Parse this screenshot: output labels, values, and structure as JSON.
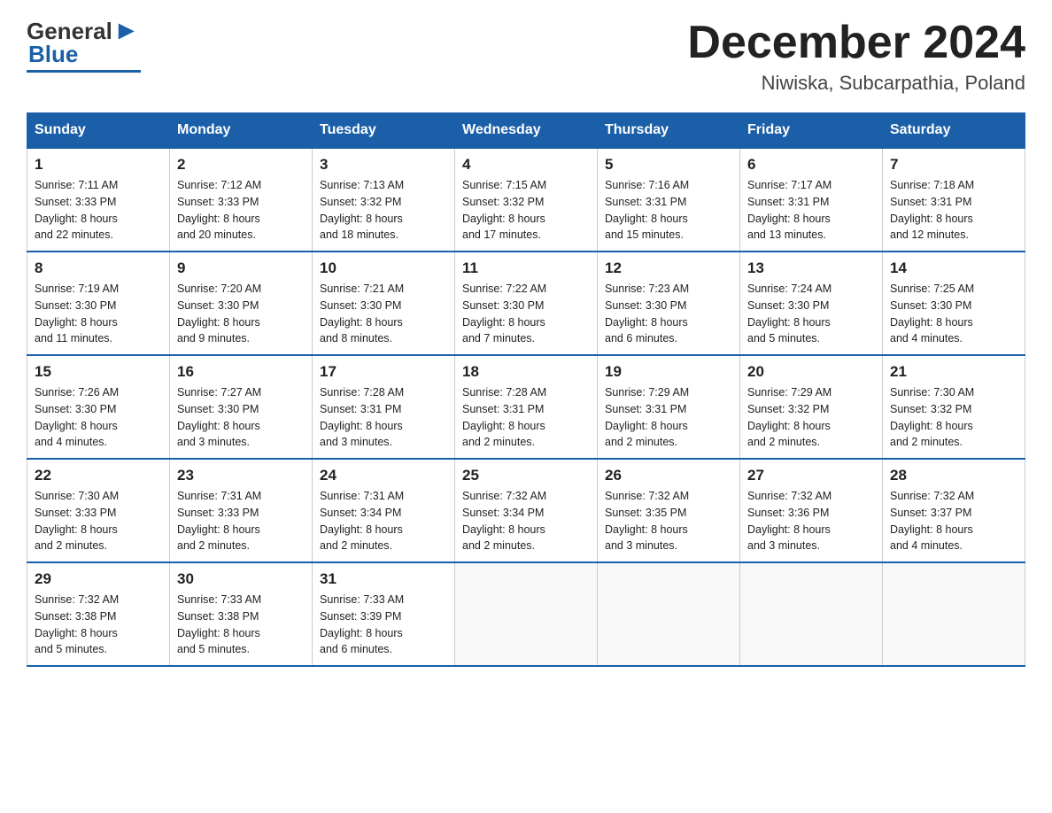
{
  "header": {
    "logo_general": "General",
    "logo_blue": "Blue",
    "month_title": "December 2024",
    "location": "Niwiska, Subcarpathia, Poland"
  },
  "days_of_week": [
    "Sunday",
    "Monday",
    "Tuesday",
    "Wednesday",
    "Thursday",
    "Friday",
    "Saturday"
  ],
  "weeks": [
    [
      {
        "day": "1",
        "sunrise": "7:11 AM",
        "sunset": "3:33 PM",
        "daylight": "8 hours and 22 minutes."
      },
      {
        "day": "2",
        "sunrise": "7:12 AM",
        "sunset": "3:33 PM",
        "daylight": "8 hours and 20 minutes."
      },
      {
        "day": "3",
        "sunrise": "7:13 AM",
        "sunset": "3:32 PM",
        "daylight": "8 hours and 18 minutes."
      },
      {
        "day": "4",
        "sunrise": "7:15 AM",
        "sunset": "3:32 PM",
        "daylight": "8 hours and 17 minutes."
      },
      {
        "day": "5",
        "sunrise": "7:16 AM",
        "sunset": "3:31 PM",
        "daylight": "8 hours and 15 minutes."
      },
      {
        "day": "6",
        "sunrise": "7:17 AM",
        "sunset": "3:31 PM",
        "daylight": "8 hours and 13 minutes."
      },
      {
        "day": "7",
        "sunrise": "7:18 AM",
        "sunset": "3:31 PM",
        "daylight": "8 hours and 12 minutes."
      }
    ],
    [
      {
        "day": "8",
        "sunrise": "7:19 AM",
        "sunset": "3:30 PM",
        "daylight": "8 hours and 11 minutes."
      },
      {
        "day": "9",
        "sunrise": "7:20 AM",
        "sunset": "3:30 PM",
        "daylight": "8 hours and 9 minutes."
      },
      {
        "day": "10",
        "sunrise": "7:21 AM",
        "sunset": "3:30 PM",
        "daylight": "8 hours and 8 minutes."
      },
      {
        "day": "11",
        "sunrise": "7:22 AM",
        "sunset": "3:30 PM",
        "daylight": "8 hours and 7 minutes."
      },
      {
        "day": "12",
        "sunrise": "7:23 AM",
        "sunset": "3:30 PM",
        "daylight": "8 hours and 6 minutes."
      },
      {
        "day": "13",
        "sunrise": "7:24 AM",
        "sunset": "3:30 PM",
        "daylight": "8 hours and 5 minutes."
      },
      {
        "day": "14",
        "sunrise": "7:25 AM",
        "sunset": "3:30 PM",
        "daylight": "8 hours and 4 minutes."
      }
    ],
    [
      {
        "day": "15",
        "sunrise": "7:26 AM",
        "sunset": "3:30 PM",
        "daylight": "8 hours and 4 minutes."
      },
      {
        "day": "16",
        "sunrise": "7:27 AM",
        "sunset": "3:30 PM",
        "daylight": "8 hours and 3 minutes."
      },
      {
        "day": "17",
        "sunrise": "7:28 AM",
        "sunset": "3:31 PM",
        "daylight": "8 hours and 3 minutes."
      },
      {
        "day": "18",
        "sunrise": "7:28 AM",
        "sunset": "3:31 PM",
        "daylight": "8 hours and 2 minutes."
      },
      {
        "day": "19",
        "sunrise": "7:29 AM",
        "sunset": "3:31 PM",
        "daylight": "8 hours and 2 minutes."
      },
      {
        "day": "20",
        "sunrise": "7:29 AM",
        "sunset": "3:32 PM",
        "daylight": "8 hours and 2 minutes."
      },
      {
        "day": "21",
        "sunrise": "7:30 AM",
        "sunset": "3:32 PM",
        "daylight": "8 hours and 2 minutes."
      }
    ],
    [
      {
        "day": "22",
        "sunrise": "7:30 AM",
        "sunset": "3:33 PM",
        "daylight": "8 hours and 2 minutes."
      },
      {
        "day": "23",
        "sunrise": "7:31 AM",
        "sunset": "3:33 PM",
        "daylight": "8 hours and 2 minutes."
      },
      {
        "day": "24",
        "sunrise": "7:31 AM",
        "sunset": "3:34 PM",
        "daylight": "8 hours and 2 minutes."
      },
      {
        "day": "25",
        "sunrise": "7:32 AM",
        "sunset": "3:34 PM",
        "daylight": "8 hours and 2 minutes."
      },
      {
        "day": "26",
        "sunrise": "7:32 AM",
        "sunset": "3:35 PM",
        "daylight": "8 hours and 3 minutes."
      },
      {
        "day": "27",
        "sunrise": "7:32 AM",
        "sunset": "3:36 PM",
        "daylight": "8 hours and 3 minutes."
      },
      {
        "day": "28",
        "sunrise": "7:32 AM",
        "sunset": "3:37 PM",
        "daylight": "8 hours and 4 minutes."
      }
    ],
    [
      {
        "day": "29",
        "sunrise": "7:32 AM",
        "sunset": "3:38 PM",
        "daylight": "8 hours and 5 minutes."
      },
      {
        "day": "30",
        "sunrise": "7:33 AM",
        "sunset": "3:38 PM",
        "daylight": "8 hours and 5 minutes."
      },
      {
        "day": "31",
        "sunrise": "7:33 AM",
        "sunset": "3:39 PM",
        "daylight": "8 hours and 6 minutes."
      },
      null,
      null,
      null,
      null
    ]
  ],
  "labels": {
    "sunrise": "Sunrise:",
    "sunset": "Sunset:",
    "daylight": "Daylight:"
  }
}
